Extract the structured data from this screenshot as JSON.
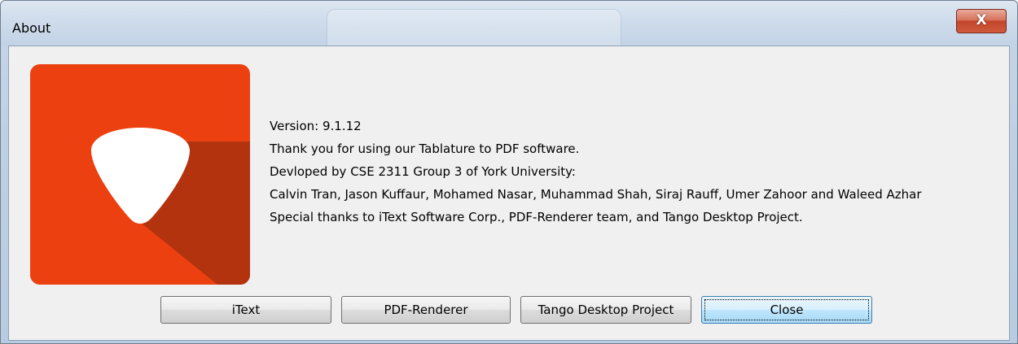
{
  "window": {
    "title": "About",
    "close_glyph": "X"
  },
  "logo": {
    "icon": "guitar-pick-icon",
    "background_color": "#ec4010",
    "shadow_color": "#b3330f",
    "pick_color": "#ffffff"
  },
  "info": {
    "version": "Version: 9.1.12",
    "thanks": "Thank you for using our Tablature to PDF software.",
    "developed_by": "Devloped by CSE 2311 Group 3 of York University:",
    "authors": "Calvin Tran, Jason Kuffaur, Mohamed Nasar, Muhammad Shah, Siraj Rauff, Umer Zahoor and Waleed Azhar",
    "special_thanks": "Special thanks to iText Software Corp., PDF-Renderer team, and Tango Desktop Project."
  },
  "buttons": {
    "itext": "iText",
    "pdf_renderer": "PDF-Renderer",
    "tango": "Tango Desktop Project",
    "close": "Close"
  }
}
